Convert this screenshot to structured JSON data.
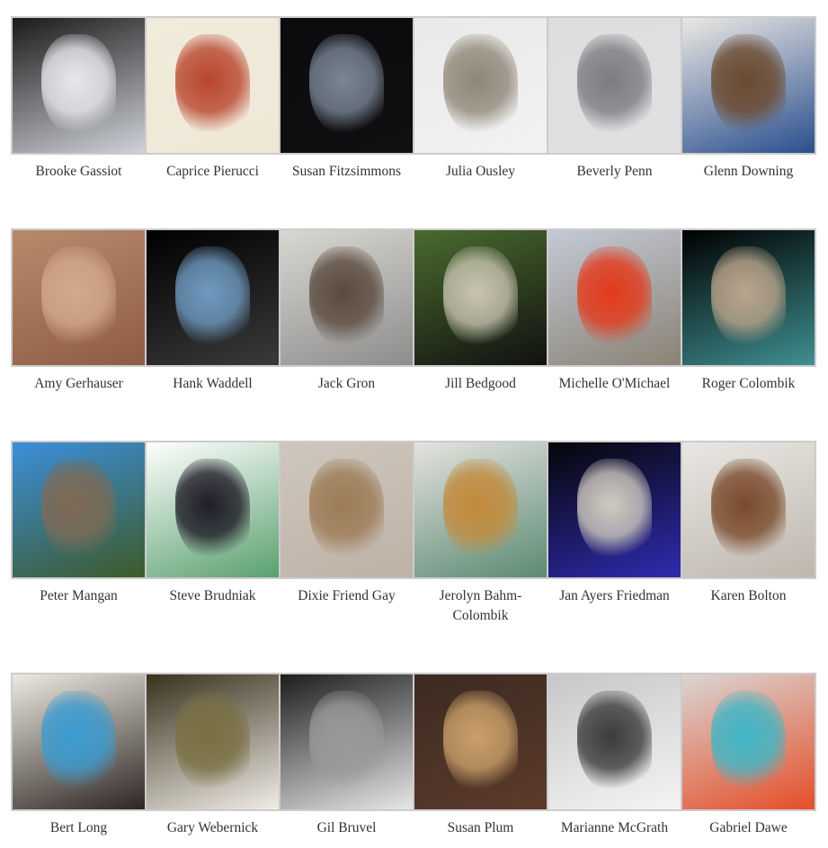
{
  "gallery": {
    "rows": [
      {
        "items": [
          {
            "name": "Brooke Gassiot",
            "image": "white-cloud-sculpture",
            "colors": [
              "#1a1a1a",
              "#e8e8ec",
              "#cfd2d8"
            ]
          },
          {
            "name": "Caprice Pierucci",
            "image": "red-wood-circle-relief",
            "colors": [
              "#f1ebdc",
              "#b8452f",
              "#efe7d6"
            ]
          },
          {
            "name": "Susan Fitzsimmons",
            "image": "tall-gray-sculpture-on-black",
            "colors": [
              "#0b0b0d",
              "#7a8594",
              "#101012"
            ]
          },
          {
            "name": "Julia Ousley",
            "image": "white-wavy-vessels",
            "colors": [
              "#e9e9e9",
              "#8f8677",
              "#f2f2f2"
            ]
          },
          {
            "name": "Beverly Penn",
            "image": "wire-circle-drawing",
            "colors": [
              "#dedee0",
              "#7c7c80",
              "#e0e0e3"
            ]
          },
          {
            "name": "Glenn Downing",
            "image": "carved-mask-totem",
            "colors": [
              "#ebe8e3",
              "#6b4a2e",
              "#2a4f8f"
            ]
          }
        ]
      },
      {
        "items": [
          {
            "name": "Amy Gerhauser",
            "image": "copper-disc-field",
            "colors": [
              "#b88a6c",
              "#d3a98d",
              "#8e5c43"
            ]
          },
          {
            "name": "Hank Waddell",
            "image": "blue-branching-sculpture",
            "colors": [
              "#000000",
              "#6f9ac0",
              "#3a3a3a"
            ]
          },
          {
            "name": "Jack Gron",
            "image": "steel-frame-outdoor-sculpture",
            "colors": [
              "#d9d7d2",
              "#5b4a3e",
              "#8d8d8d"
            ]
          },
          {
            "name": "Jill Bedgood",
            "image": "rose-field-collage",
            "colors": [
              "#4a6b2e",
              "#c8c4b0",
              "#111111"
            ]
          },
          {
            "name": "Michelle O'Michael",
            "image": "red-abstract-public-sculpture",
            "colors": [
              "#c4c9d6",
              "#e33a1b",
              "#8a8375"
            ]
          },
          {
            "name": "Roger Colombik",
            "image": "teal-fin-sculptures",
            "colors": [
              "#000000",
              "#bba58c",
              "#3f8f91"
            ]
          }
        ]
      },
      {
        "items": [
          {
            "name": "Peter Mangan",
            "image": "wavy-tower-palm-trees",
            "colors": [
              "#3b8fdb",
              "#7f6a55",
              "#3d5a2a"
            ]
          },
          {
            "name": "Steve Brudniak",
            "image": "dark-porthole-wall-piece",
            "colors": [
              "#ffffff",
              "#1f1d26",
              "#5aa06f"
            ]
          },
          {
            "name": "Dixie Friend Gay",
            "image": "wire-ring-wall-sculpture",
            "colors": [
              "#cfc6bd",
              "#9c7b56",
              "#bdb2a6"
            ]
          },
          {
            "name": "Jerolyn Bahm-Colombik",
            "image": "woven-figure-sculpture",
            "colors": [
              "#e5e3df",
              "#c28a3a",
              "#5b8a72"
            ]
          },
          {
            "name": "Jan Ayers Friedman",
            "image": "fused-glass-tiles",
            "colors": [
              "#060606",
              "#cfcac0",
              "#2e2bb0"
            ]
          },
          {
            "name": "Karen Bolton",
            "image": "gallery-wall-panels",
            "colors": [
              "#e9e7e3",
              "#7a4a2c",
              "#bdb7ad"
            ]
          }
        ]
      },
      {
        "items": [
          {
            "name": "Bert Long",
            "image": "visitors-at-colorful-installation",
            "colors": [
              "#ede9e2",
              "#3a9bd1",
              "#2d2622"
            ]
          },
          {
            "name": "Gary Webernick",
            "image": "camouflage-wall-sculpture",
            "colors": [
              "#38311e",
              "#7a7042",
              "#f1ede6"
            ]
          },
          {
            "name": "Gil Bruvel",
            "image": "ribbon-bust-sculpture",
            "colors": [
              "#1d1d1d",
              "#9a9a9a",
              "#e7e7e7"
            ]
          },
          {
            "name": "Susan Plum",
            "image": "glowing-wire-chandelier",
            "colors": [
              "#3d2a22",
              "#caa06a",
              "#5c3b2b"
            ]
          },
          {
            "name": "Marianne McGrath",
            "image": "insulator-paper-sculpture",
            "colors": [
              "#c7c7c9",
              "#3b3b3b",
              "#f4f4f4"
            ]
          },
          {
            "name": "Gabriel Dawe",
            "image": "rainbow-thread-installation",
            "colors": [
              "#d9d6d3",
              "#3fb6c6",
              "#e64d28"
            ]
          }
        ]
      }
    ]
  }
}
